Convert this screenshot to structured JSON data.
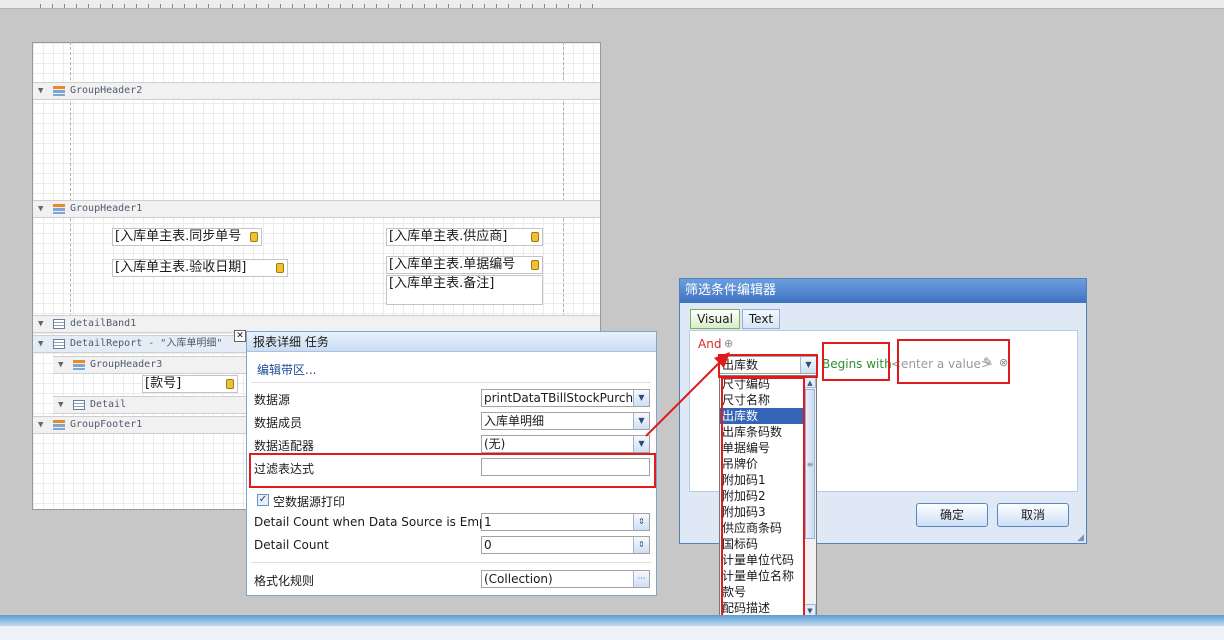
{
  "bands": {
    "group_header2": "GroupHeader2",
    "group_header1": "GroupHeader1",
    "detail_band1": "detailBand1",
    "detail_report": "DetailReport - \"入库单明细\"",
    "group_header3": "GroupHeader3",
    "detail": "Detail",
    "group_footer1": "GroupFooter1"
  },
  "fields": {
    "sync_no": "[入库单主表.同步单号",
    "supplier": "[入库单主表.供应商]",
    "receive_date": "[入库单主表.验收日期]",
    "bill_no": "[入库单主表.单据编号",
    "remark": "[入库单主表.备注]",
    "style_no": "[款号]"
  },
  "tasks": {
    "title": "报表详细 任务",
    "edit_bands": "编辑带区...",
    "datasource_label": "数据源",
    "datasource_value": "printDataTBillStockPurchas",
    "datamember_label": "数据成员",
    "datamember_value": "入库单明细",
    "adapter_label": "数据适配器",
    "adapter_value": "(无)",
    "filter_label": "过滤表达式",
    "filter_value": "",
    "print_empty_label": "空数据源打印",
    "detail_count_empty_label": "Detail Count when Data Source is Empty",
    "detail_count_empty_value": "1",
    "detail_count_label": "Detail Count",
    "detail_count_value": "0",
    "format_rules_label": "格式化规则",
    "format_rules_value": "(Collection)"
  },
  "filter_dialog": {
    "title": "筛选条件编辑器",
    "tab_visual": "Visual",
    "tab_text": "Text",
    "and_label": "And",
    "field_value": "出库数",
    "operator": "Begins with",
    "value_placeholder": "<enter a value>",
    "ok": "确定",
    "cancel": "取消"
  },
  "dropdown_items": [
    "尺寸编码",
    "尺寸名称",
    "出库数",
    "出库条码数",
    "单据编号",
    "吊牌价",
    "附加码1",
    "附加码2",
    "附加码3",
    "供应商条码",
    "国标码",
    "计量单位代码",
    "计量单位名称",
    "款号",
    "配码描述"
  ],
  "dropdown_selected_index": 2,
  "colors": {
    "highlight": "#e01b1b",
    "selection": "#3563b5",
    "accent": "#4f80c0"
  }
}
